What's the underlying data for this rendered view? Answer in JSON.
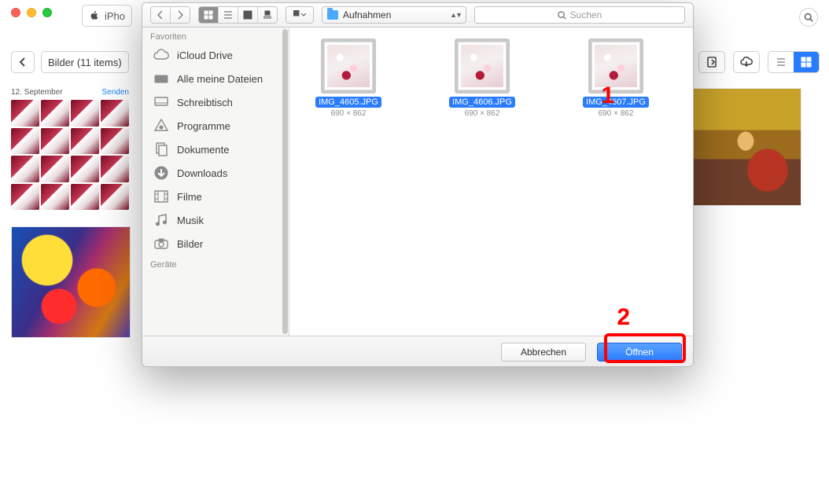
{
  "main_window": {
    "device_label": "iPho",
    "back_breadcrumb": "Bilder (11 items)",
    "album_header_date": "12. September",
    "album_header_action": "Senden"
  },
  "dialog": {
    "folder_name": "Aufnahmen",
    "search_placeholder": "Suchen",
    "sidebar": {
      "section_favorites": "Favoriten",
      "section_devices": "Geräte",
      "items": [
        {
          "label": "iCloud Drive",
          "icon": "cloud"
        },
        {
          "label": "Alle meine Dateien",
          "icon": "tray"
        },
        {
          "label": "Schreibtisch",
          "icon": "desktop"
        },
        {
          "label": "Programme",
          "icon": "apps"
        },
        {
          "label": "Dokumente",
          "icon": "docs"
        },
        {
          "label": "Downloads",
          "icon": "download"
        },
        {
          "label": "Filme",
          "icon": "film"
        },
        {
          "label": "Musik",
          "icon": "music"
        },
        {
          "label": "Bilder",
          "icon": "camera"
        }
      ]
    },
    "files": [
      {
        "name": "IMG_4605.JPG",
        "dim": "690 × 862",
        "selected": true
      },
      {
        "name": "IMG_4606.JPG",
        "dim": "690 × 862",
        "selected": true
      },
      {
        "name": "IMG_4607.JPG",
        "dim": "690 × 862",
        "selected": true
      }
    ],
    "footer": {
      "cancel": "Abbrechen",
      "open": "Öffnen"
    }
  },
  "annotations": {
    "one": "1",
    "two": "2"
  }
}
